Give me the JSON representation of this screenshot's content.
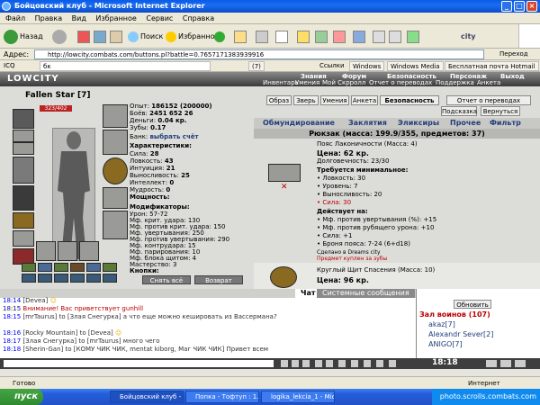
{
  "window": {
    "title": "Бойцовский клуб - Microsoft Internet Explorer"
  },
  "menu": [
    "Файл",
    "Правка",
    "Вид",
    "Избранное",
    "Сервис",
    "Справка"
  ],
  "toolbar": {
    "back": "Назад",
    "search": "Поиск",
    "favorites": "Избранное"
  },
  "address": {
    "label": "Адрес:",
    "url": "http://lowcity.combats.com/buttons.pl?battle=0.7657171383939916",
    "go": "Переход"
  },
  "links": {
    "icq": "ICQ",
    "search_text": "бк",
    "page_count": "(7)",
    "links_label": "Ссылки",
    "items": [
      "Windows",
      "Windows Media",
      "Бесплатная почта Hotmail"
    ]
  },
  "game": {
    "logo": "LOWCITY",
    "top_nav": [
      "Знания",
      "Форум"
    ],
    "top_nav2": [
      "Инвентарь",
      "Умения",
      "Мой Скрролл",
      "Отчет о переводах",
      "Поддержка",
      "Анкета"
    ],
    "top_nav_right": [
      "Безопасность",
      "Персонаж",
      "Выход"
    ],
    "character": {
      "name": "Fallen Star",
      "level": "[7]",
      "hp": "323/402",
      "exp_label": "Опыт:",
      "exp": "186152 (200000)",
      "fights_label": "Боёв:",
      "fights": "2451",
      "wins": "652",
      "losses": "26",
      "money_label": "Деньги:",
      "money": "0.04 кр.",
      "teeth_label": "Зубы:",
      "teeth": "0.17",
      "bank_label": "Банк:",
      "bank_link": "выбрать счёт",
      "section_stats": "Характеристики:",
      "stats": [
        {
          "label": "Сила:",
          "value": "28"
        },
        {
          "label": "Ловкость:",
          "value": "43"
        },
        {
          "label": "Интуиция:",
          "value": "21"
        },
        {
          "label": "Выносливость:",
          "value": "25"
        },
        {
          "label": "Интеллект:",
          "value": "0"
        },
        {
          "label": "Мудрость:",
          "value": "0"
        }
      ],
      "section_power": "Мощность:",
      "section_mods": "Модификаторы:",
      "mods": [
        {
          "label": "Урон:",
          "value": "57-72"
        },
        {
          "label": "Мф. крит. удара:",
          "value": "130"
        },
        {
          "label": "Мф. против крит. удара:",
          "value": "150"
        },
        {
          "label": "Мф. увертывания:",
          "value": "250"
        },
        {
          "label": "Мф. против увертывания:",
          "value": "290"
        },
        {
          "label": "Мф. контрудара:",
          "value": "15"
        },
        {
          "label": "Мф. парирования:",
          "value": "10"
        },
        {
          "label": "Мф. блока щитом:",
          "value": "4"
        },
        {
          "label": "Мастерство:",
          "value": "3"
        }
      ],
      "section_buttons": "Кнопки:",
      "remove_all": "Снять всё",
      "return_btn": "Возврат"
    },
    "right_tabs": [
      "Образ",
      "Зверь",
      "Умения",
      "Анкета",
      "Безопасность",
      "Отчет о переводах"
    ],
    "hint": "Подсказка",
    "back": "Вернуться",
    "categories": [
      "Обмундирование",
      "Заклятия",
      "Эликсиры",
      "Прочее",
      "Фильтр"
    ],
    "backpack": "Рюкзак (масса: 199.9/355, предметов: 37)",
    "item1": {
      "name": "Пояс Лаконичности",
      "mass": "(Масса: 4)",
      "price": "Цена: 62 кр.",
      "durability": "Долговечность: 23/30",
      "req_header": "Требуется минимальное:",
      "reqs": [
        "• Ловкость: 30",
        "• Уровень: 7",
        "• Выносливость: 20"
      ],
      "req_red": "• Сила: 30",
      "effect_header": "Действует на:",
      "effects": [
        "• Мф. против увертывания (%): +15",
        "• Мф. против рубящего урона: +10",
        "• Сила: +1",
        "• Броня пояса: 7-24 (6+d18)"
      ],
      "made": "Сделано в Dreams city",
      "warning": "Предмет куплен за зубы"
    },
    "item2": {
      "name": "Круглый Щит Спасения",
      "mass": "(Масса: 10)",
      "price": "Цена: 96 кр."
    }
  },
  "chat": {
    "tabs": [
      "Чат",
      "Системные сообщения"
    ],
    "lines": [
      {
        "time": "18:14",
        "text": "[Devea]"
      },
      {
        "time": "18:15",
        "text": "Внимание! Вас приветствует gunhill"
      },
      {
        "time": "18:15",
        "text": "[mrTaurus] to [Злая Снегурка] а что еще можно кешировать из Вассермана?"
      },
      {
        "time": "18:16",
        "text": "[Rocky Mountain] to [Devea]"
      },
      {
        "time": "18:17",
        "text": "[Злая Снегурка] to [mrTaurus] много чего"
      },
      {
        "time": "18:18",
        "text": "[Sherin-Gan] to [КОМУ ЧИК ЧИК, mentat kiborg, Маг ЧИК ЧИК] Привет всем"
      }
    ]
  },
  "online": {
    "refresh": "Обновить",
    "room": "Зал воинов (107)",
    "users": [
      {
        "name": "akaz",
        "level": "[7]"
      },
      {
        "name": "Alexandr Sever",
        "level": "[2]"
      },
      {
        "name": "ANIGO",
        "level": "[7]"
      }
    ]
  },
  "statusbar": {
    "text": "Готово",
    "zone": "Интернет",
    "clock": "18:18"
  },
  "taskbar": {
    "start": "пуск",
    "tasks": [
      "Бойцовский клуб - M...",
      "Попка - Тофтуп : 1...",
      "logika_lekcia_1 - Micr..."
    ],
    "watermark": "photo.scrolls.combats.com"
  }
}
